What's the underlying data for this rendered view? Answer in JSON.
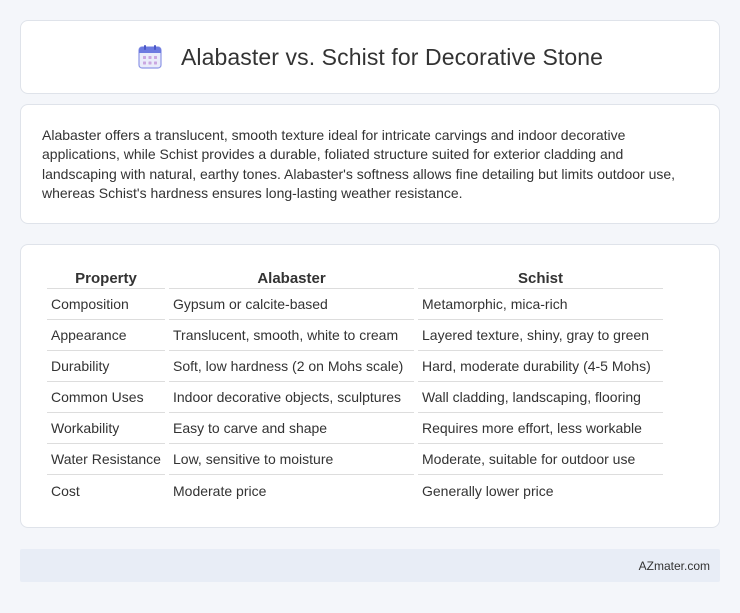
{
  "header": {
    "title": "Alabaster vs. Schist for Decorative Stone",
    "icon": "calendar-icon"
  },
  "intro": {
    "text": "Alabaster offers a translucent, smooth texture ideal for intricate carvings and indoor decorative applications, while Schist provides a durable, foliated structure suited for exterior cladding and landscaping with natural, earthy tones. Alabaster's softness allows fine detailing but limits outdoor use, whereas Schist's hardness ensures long-lasting weather resistance."
  },
  "table": {
    "headers": [
      "Property",
      "Alabaster",
      "Schist"
    ],
    "rows": [
      [
        "Composition",
        "Gypsum or calcite-based",
        "Metamorphic, mica-rich"
      ],
      [
        "Appearance",
        "Translucent, smooth, white to cream",
        "Layered texture, shiny, gray to green"
      ],
      [
        "Durability",
        "Soft, low hardness (2 on Mohs scale)",
        "Hard, moderate durability (4-5 Mohs)"
      ],
      [
        "Common Uses",
        "Indoor decorative objects, sculptures",
        "Wall cladding, landscaping, flooring"
      ],
      [
        "Workability",
        "Easy to carve and shape",
        "Requires more effort, less workable"
      ],
      [
        "Water Resistance",
        "Low, sensitive to moisture",
        "Moderate, suitable for outdoor use"
      ],
      [
        "Cost",
        "Moderate price",
        "Generally lower price"
      ]
    ]
  },
  "footer": {
    "brand": "AZmater.com"
  }
}
